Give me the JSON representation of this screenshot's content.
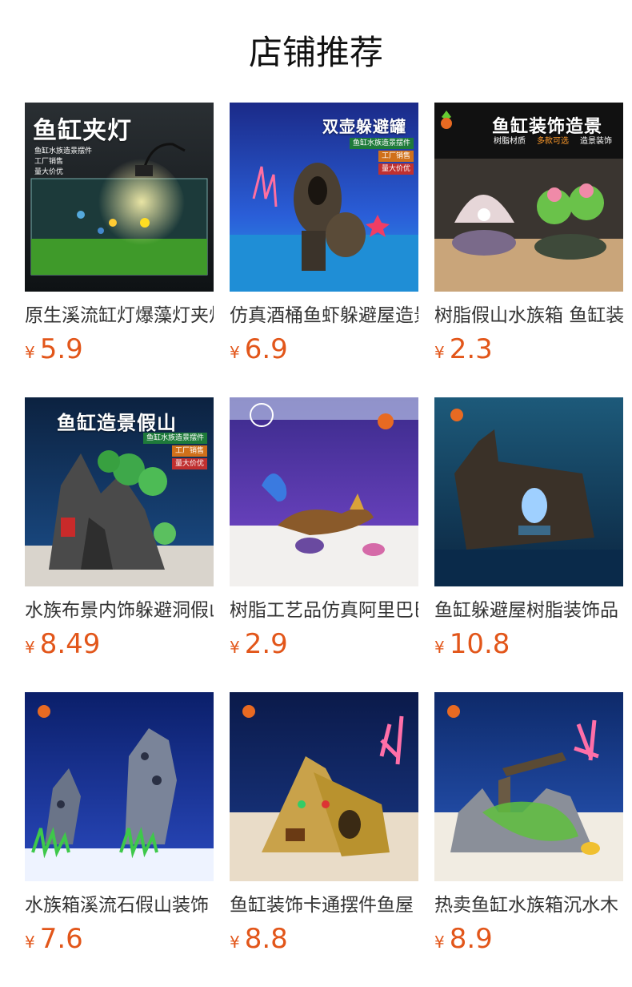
{
  "section": {
    "title": "店铺推荐"
  },
  "currency_symbol": "¥",
  "products": [
    {
      "title": "原生溪流缸灯爆藻灯夹灯",
      "price": "5.9",
      "image_texts": [
        "鱼缸夹灯",
        "鱼缸水族造景摆件",
        "工厂销售",
        "量大价优"
      ]
    },
    {
      "title": "仿真酒桶鱼虾躲避屋造景",
      "price": "6.9",
      "image_texts": [
        "双壶躲避罐",
        "鱼缸水族造景摆件",
        "工厂销售",
        "量大价优"
      ]
    },
    {
      "title": "树脂假山水族箱 鱼缸装饰",
      "price": "2.3",
      "image_texts": [
        "鱼缸装饰造景",
        "树脂材质",
        "多款可选",
        "造景装饰"
      ]
    },
    {
      "title": "水族布景内饰躲避洞假山",
      "price": "8.49",
      "image_texts": [
        "鱼缸造景假山",
        "鱼缸水族造景摆件",
        "工厂销售",
        "量大价优"
      ]
    },
    {
      "title": "树脂工艺品仿真阿里巴巴",
      "price": "2.9",
      "image_texts": []
    },
    {
      "title": "鱼缸躲避屋树脂装饰品",
      "price": "10.8",
      "image_texts": []
    },
    {
      "title": "水族箱溪流石假山装饰",
      "price": "7.6",
      "image_texts": []
    },
    {
      "title": "鱼缸装饰卡通摆件鱼屋",
      "price": "8.8",
      "image_texts": []
    },
    {
      "title": "热卖鱼缸水族箱沉水木",
      "price": "8.9",
      "image_texts": []
    }
  ],
  "colors": {
    "price": "#e2561a",
    "title": "#111111"
  }
}
